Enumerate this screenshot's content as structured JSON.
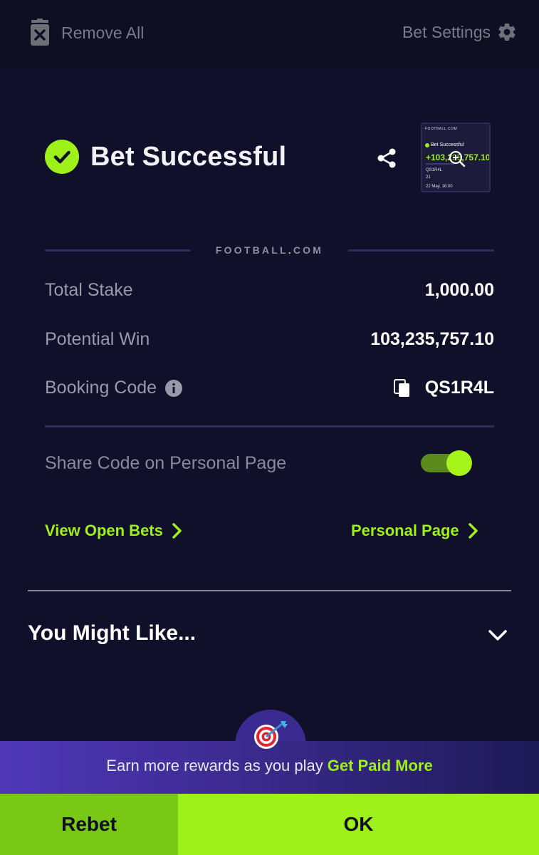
{
  "topbar": {
    "remove_all_label": "Remove All",
    "bet_settings_label": "Bet Settings"
  },
  "status": {
    "title": "Bet Successful",
    "accent_color": "#9ef01a"
  },
  "thumbnail": {
    "brand": "FOOTBALL.COM",
    "title": "Bet Successful",
    "potential_win": "+103,235,757.10",
    "code": "QS1R4L",
    "count": "21",
    "date": "22 May, 16:00"
  },
  "brand": {
    "name_part1": "FOOTBALL",
    "dot": ".",
    "name_part2": "COM"
  },
  "summary": {
    "total_stake_label": "Total Stake",
    "total_stake_value": "1,000.00",
    "potential_win_label": "Potential Win",
    "potential_win_value": "103,235,757.10",
    "booking_code_label": "Booking Code",
    "booking_code_value": "QS1R4L"
  },
  "share_code": {
    "label": "Share Code on Personal Page",
    "enabled": true
  },
  "links": {
    "view_open_bets": "View Open Bets",
    "personal_page": "Personal Page"
  },
  "recommendations": {
    "title": "You Might Like..."
  },
  "promo": {
    "text": "Earn more rewards as you play",
    "cta": "Get Paid More"
  },
  "actions": {
    "rebet_label": "Rebet",
    "ok_label": "OK"
  }
}
